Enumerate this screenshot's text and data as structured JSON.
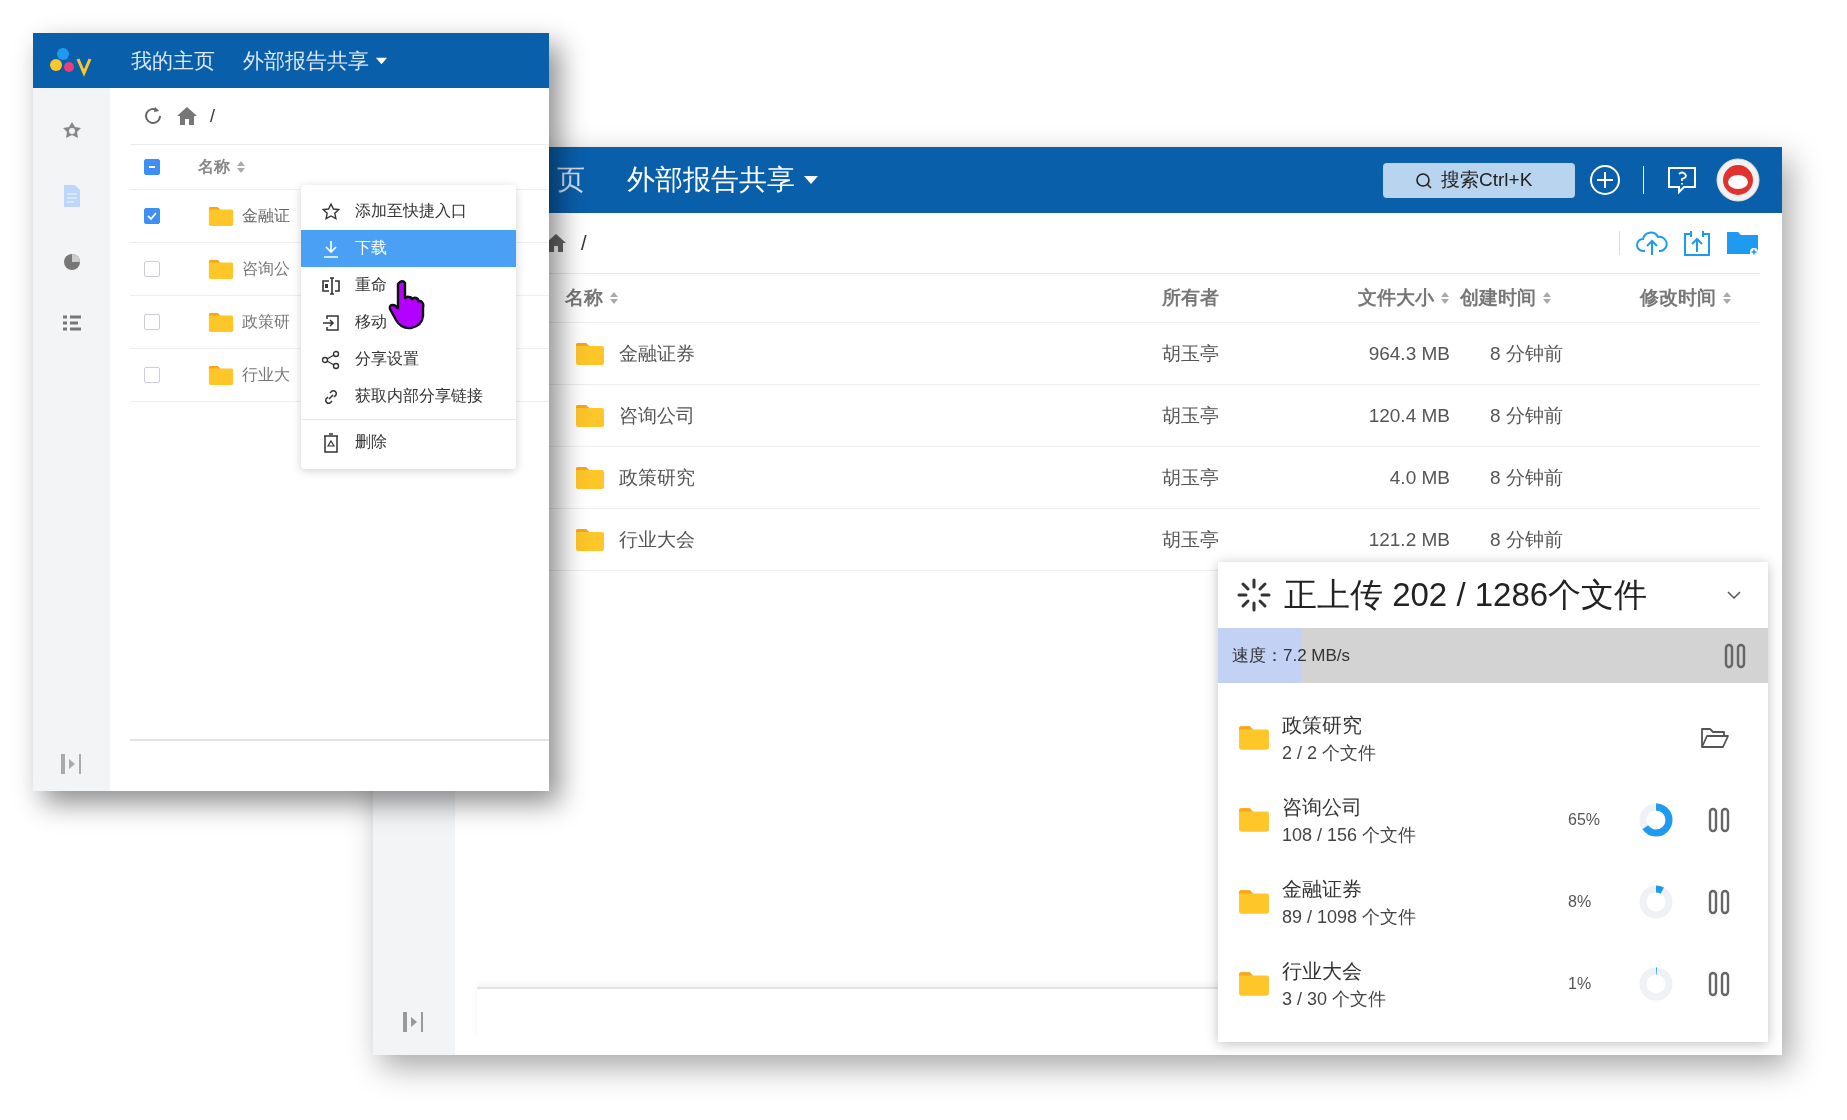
{
  "back_window": {
    "header": {
      "nav": [
        {
          "label": "页",
          "dropdown": false
        },
        {
          "label": "外部报告共享",
          "dropdown": true
        }
      ],
      "search": {
        "placeholder": "搜索Ctrl+K"
      }
    },
    "breadcrumb": "/",
    "table": {
      "columns": [
        {
          "label": "名称",
          "sortable": true
        },
        {
          "label": "所有者",
          "sortable": false
        },
        {
          "label": "文件大小",
          "sortable": true
        },
        {
          "label": "创建时间",
          "sortable": true
        },
        {
          "label": "修改时间",
          "sortable": true
        }
      ],
      "rows": [
        {
          "name": "金融证券",
          "owner": "胡玉亭",
          "size": "964.3 MB",
          "created": "8 分钟前"
        },
        {
          "name": "咨询公司",
          "owner": "胡玉亭",
          "size": "120.4 MB",
          "created": "8 分钟前"
        },
        {
          "name": "政策研究",
          "owner": "胡玉亭",
          "size": "4.0 MB",
          "created": "8 分钟前"
        },
        {
          "name": "行业大会",
          "owner": "胡玉亭",
          "size": "121.2 MB",
          "created": "8 分钟前"
        }
      ]
    }
  },
  "front_window": {
    "header": {
      "nav": [
        {
          "label": "我的主页",
          "dropdown": false
        },
        {
          "label": "外部报告共享",
          "dropdown": true
        }
      ]
    },
    "breadcrumb": "/",
    "table": {
      "header_checkbox": {
        "indeterminate": true
      },
      "column": "名称",
      "rows": [
        {
          "name": "金融证",
          "checked": true
        },
        {
          "name": "咨询公",
          "checked": false
        },
        {
          "name": "政策研",
          "checked": false
        },
        {
          "name": "行业大",
          "checked": false
        }
      ]
    },
    "context_menu": {
      "sections": [
        [
          {
            "label": "添加至快捷入口",
            "selected": false
          },
          {
            "label": "下载",
            "selected": true
          },
          {
            "label": "重命",
            "selected": false
          },
          {
            "label": "移动",
            "selected": false
          },
          {
            "label": "分享设置",
            "selected": false
          },
          {
            "label": "获取内部分享链接",
            "selected": false
          }
        ],
        [
          {
            "label": "删除",
            "selected": false
          }
        ]
      ]
    }
  },
  "upload_panel": {
    "title": "正上传 202 / 1286个文件",
    "speed": {
      "label": "速度：7.2 MB/s",
      "level": 0.15
    },
    "items": [
      {
        "kind": "done",
        "name": "政策研究",
        "count": "2 / 2 个文件"
      },
      {
        "kind": "uploading",
        "name": "咨询公司",
        "count": "108 / 156 个文件",
        "percent": "65%",
        "level": 0.65
      },
      {
        "kind": "uploading",
        "name": "金融证券",
        "count": "89 / 1098 个文件",
        "percent": "8%",
        "level": 0.08
      },
      {
        "kind": "uploading",
        "name": "行业大会",
        "count": "3 / 30 个文件",
        "percent": "1%",
        "level": 0.01
      }
    ]
  }
}
